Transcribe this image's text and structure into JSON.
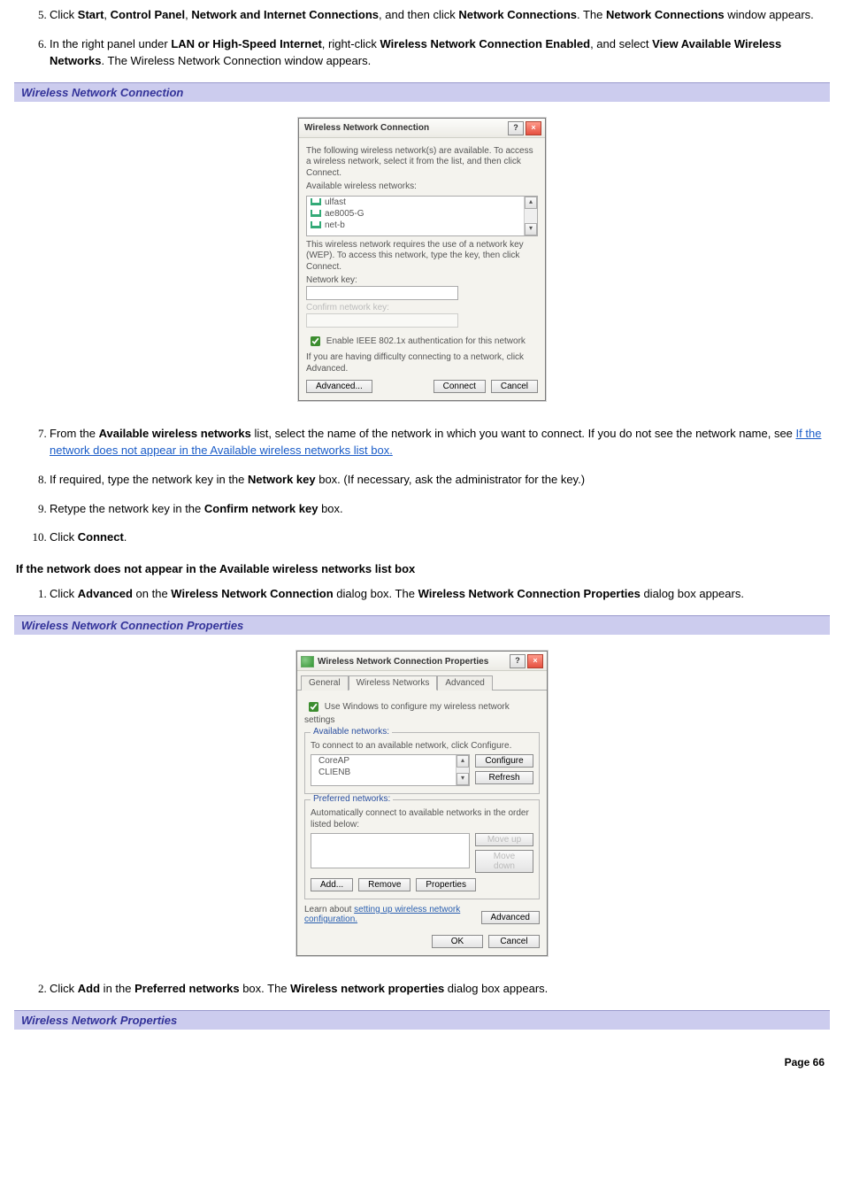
{
  "steps_a": [
    {
      "num": "5.",
      "pre": "Click ",
      "b1": "Start",
      "sep1": ", ",
      "b2": "Control Panel",
      "sep2": ", ",
      "b3": "Network and Internet Connections",
      "sep3": ", and then click ",
      "b4": "Network Connections",
      "sep4": ". The ",
      "b5": "Network Connections",
      "post": " window appears."
    },
    {
      "num": "6.",
      "pre": "In the right panel under ",
      "b1": "LAN or High-Speed Internet",
      "sep1": ", right-click ",
      "b2": "Wireless Network Connection Enabled",
      "sep2": ", and select ",
      "b3": "View Available Wireless Networks",
      "post": ". The Wireless Network Connection window appears."
    }
  ],
  "header1": "Wireless Network Connection",
  "dlg1": {
    "title": "Wireless Network Connection",
    "intro": "The following wireless network(s) are available. To access a wireless network, select it from the list, and then click Connect.",
    "avail_label": "Available wireless networks:",
    "networks": [
      "ulfast",
      "ae8005-G",
      "net-b"
    ],
    "wep_note": "This wireless network requires the use of a network key (WEP). To access this network, type the key, then click Connect.",
    "netkey_label": "Network key:",
    "confirm_label": "Confirm network key:",
    "ieee": "Enable IEEE 802.1x authentication for this network",
    "diff": "If you are having difficulty connecting to a network, click Advanced.",
    "btn_adv": "Advanced...",
    "btn_connect": "Connect",
    "btn_cancel": "Cancel"
  },
  "steps_b": [
    {
      "num": "7.",
      "pre": "From the ",
      "b1": "Available wireless networks",
      "mid": " list, select the name of the network in which you want to connect. If you do not see the network name, see ",
      "link": "If the network does not appear in the Available wireless networks list box."
    },
    {
      "num": "8.",
      "pre": "If required, type the network key in the ",
      "b1": "Network key",
      "post": " box. (If necessary, ask the administrator for the key.)"
    },
    {
      "num": "9.",
      "pre": "Retype the network key in the ",
      "b1": "Confirm network key",
      "post": " box."
    },
    {
      "num": "10.",
      "pre": "Click ",
      "b1": "Connect",
      "post": "."
    }
  ],
  "subheading": "If the network does not appear in the Available wireless networks list box",
  "steps_c": [
    {
      "num": "1.",
      "pre": "Click ",
      "b1": "Advanced",
      "sep1": " on the ",
      "b2": "Wireless Network Connection",
      "sep2": " dialog box. The ",
      "b3": "Wireless Network Connection Properties",
      "post": " dialog box appears."
    }
  ],
  "header2": "Wireless Network Connection Properties",
  "dlg2": {
    "title": "Wireless Network Connection Properties",
    "tabs": [
      "General",
      "Wireless Networks",
      "Advanced"
    ],
    "use_windows": "Use Windows to configure my wireless network settings",
    "avail_legend": "Available networks:",
    "avail_hint": "To connect to an available network, click Configure.",
    "avail_items": [
      "CoreAP",
      "CLIENB"
    ],
    "btn_configure": "Configure",
    "btn_refresh": "Refresh",
    "pref_legend": "Preferred networks:",
    "pref_hint": "Automatically connect to available networks in the order listed below:",
    "btn_moveup": "Move up",
    "btn_movedown": "Move down",
    "btn_add": "Add...",
    "btn_remove": "Remove",
    "btn_props": "Properties",
    "learn_pre": "Learn about ",
    "learn_link": "setting up wireless network configuration.",
    "btn_adv": "Advanced",
    "btn_ok": "OK",
    "btn_cancel": "Cancel"
  },
  "steps_d": [
    {
      "num": "2.",
      "pre": "Click ",
      "b1": "Add",
      "sep1": " in the ",
      "b2": "Preferred networks",
      "sep2": " box. The ",
      "b3": "Wireless network properties",
      "post": " dialog box appears."
    }
  ],
  "header3": "Wireless Network Properties",
  "page_footer": "Page 66"
}
